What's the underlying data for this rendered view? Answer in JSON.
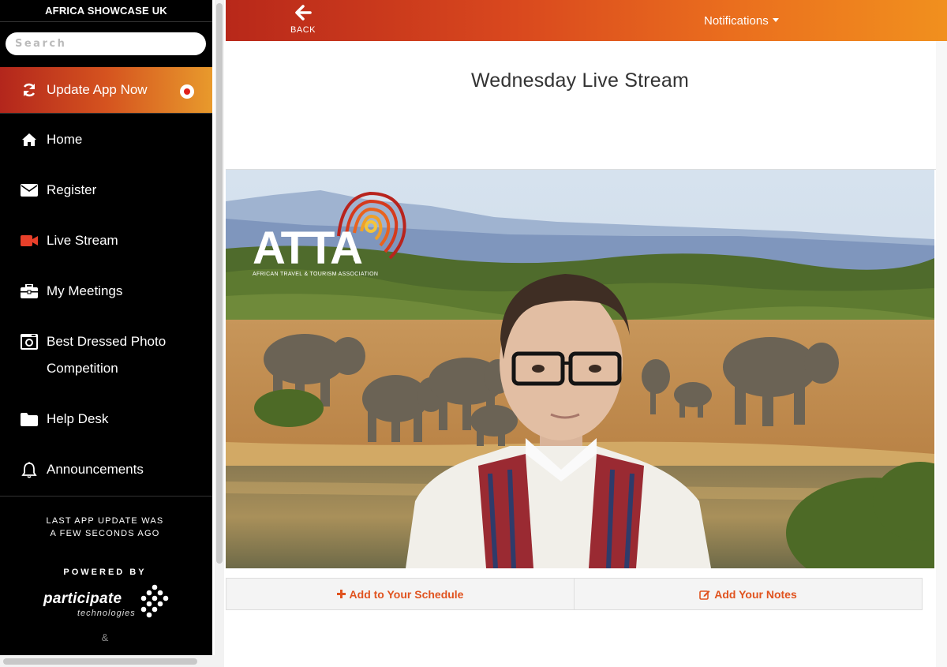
{
  "sidebar": {
    "title": "AFRICA SHOWCASE UK",
    "search_placeholder": "Search",
    "update": {
      "label": "Update App Now",
      "icon": "refresh-icon"
    },
    "items": [
      {
        "label": "Home",
        "icon": "home-icon"
      },
      {
        "label": "Register",
        "icon": "envelope-icon"
      },
      {
        "label": "Live Stream",
        "icon": "video-camera-icon"
      },
      {
        "label": "My Meetings",
        "icon": "briefcase-icon"
      },
      {
        "label": "Best Dressed Photo\nCompetition",
        "icon": "camera-icon"
      },
      {
        "label": "Help Desk",
        "icon": "folder-icon"
      },
      {
        "label": "Announcements",
        "icon": "bell-icon"
      }
    ],
    "last_update": "LAST APP UPDATE WAS\nA FEW SECONDS AGO",
    "powered_by": "POWERED BY",
    "powered_logo": {
      "name": "participate",
      "sub": "technologies"
    },
    "ampersand": "&"
  },
  "topbar": {
    "back_label": "BACK",
    "notifications_label": "Notifications"
  },
  "main": {
    "title": "Wednesday Live Stream",
    "video": {
      "logo_text": "ATTA",
      "logo_mark": "®",
      "logo_subtitle": "AFRICAN TRAVEL & TOURISM ASSOCIATION"
    },
    "actions": {
      "schedule_label": "Add to Your Schedule",
      "notes_label": "Add Your Notes"
    }
  },
  "colors": {
    "accent_dark": "#b8281a",
    "accent_mid": "#d9481e",
    "accent_light": "#f1901e",
    "action_text": "#e0531f",
    "sidebar_bg": "#000000"
  }
}
